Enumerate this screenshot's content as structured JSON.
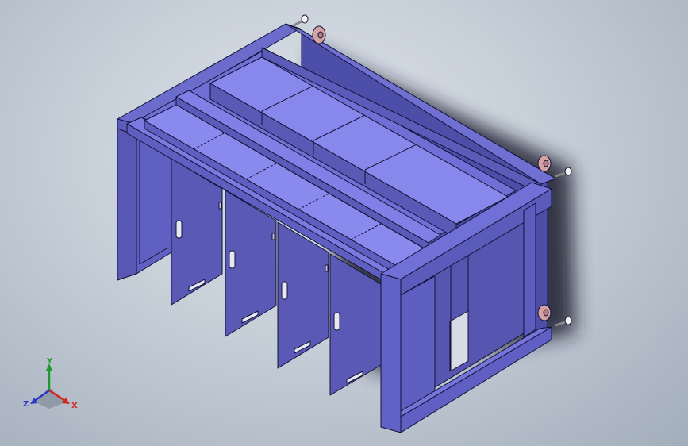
{
  "viewport": {
    "model": "cabinet-frame-assembly",
    "background": "#c6ced8",
    "body_color": "#5e5fc0",
    "panel_color": "#5a5ab6",
    "highlight_color": "#8888ec",
    "edge_color": "#121236",
    "caster_color": "#d4a2a4"
  },
  "triad": {
    "x_label": "X",
    "y_label": "Y",
    "z_label": "Z",
    "x_color": "#d0281f",
    "y_color": "#1f9a2a",
    "z_color": "#2b39c6"
  }
}
